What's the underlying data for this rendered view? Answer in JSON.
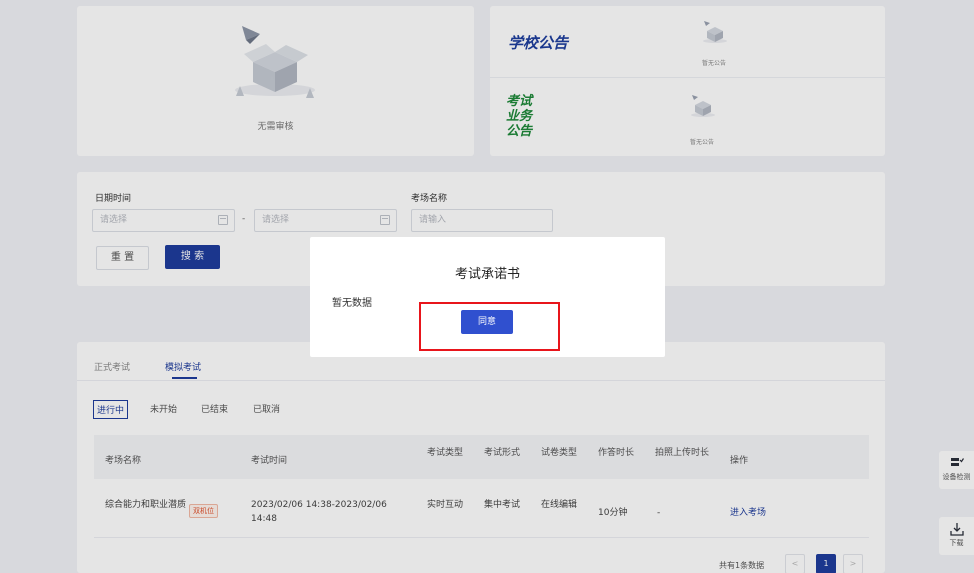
{
  "audit": {
    "empty_text": "无需审核"
  },
  "notices": {
    "school_title": "学校公告",
    "exam_title": "考试业务公告",
    "empty_text": "暂无公告"
  },
  "search": {
    "date_label": "日期时间",
    "date_start_placeholder": "请选择",
    "date_end_placeholder": "请选择",
    "date_separator": "-",
    "room_label": "考场名称",
    "room_placeholder": "请输入",
    "reset_button": "重 置",
    "search_button": "搜 索"
  },
  "tabs": [
    "正式考试",
    "模拟考试"
  ],
  "active_tab": "模拟考试",
  "subtabs": [
    "进行中",
    "未开始",
    "已结束",
    "已取消"
  ],
  "active_subtab": "进行中",
  "table": {
    "headers": [
      "考场名称",
      "考试时间",
      "考试类型",
      "考试形式",
      "试卷类型",
      "作答时长",
      "拍照上传时长",
      "操作"
    ],
    "rows": [
      {
        "name": "综合能力和职业潜质",
        "tag": "双机位",
        "time": "2023/02/06 14:38-2023/02/06 14:48",
        "type": "实时互动",
        "form": "集中考试",
        "paper": "在线编辑",
        "duration": "10分钟",
        "photo": "-",
        "action": "进入考场"
      }
    ]
  },
  "pagination": {
    "total_text": "共有1条数据",
    "prev": "<",
    "current": "1",
    "next": ">"
  },
  "side_tools": {
    "device_check": "设备检测",
    "download": "下载"
  },
  "modal": {
    "title": "考试承诺书",
    "body": "暂无数据",
    "agree_button": "同意"
  },
  "colors": {
    "primary": "#1f3d9e",
    "modal_button": "#3050cf",
    "highlight": "#e8151b",
    "exam_notice": "#1f8a3a"
  }
}
